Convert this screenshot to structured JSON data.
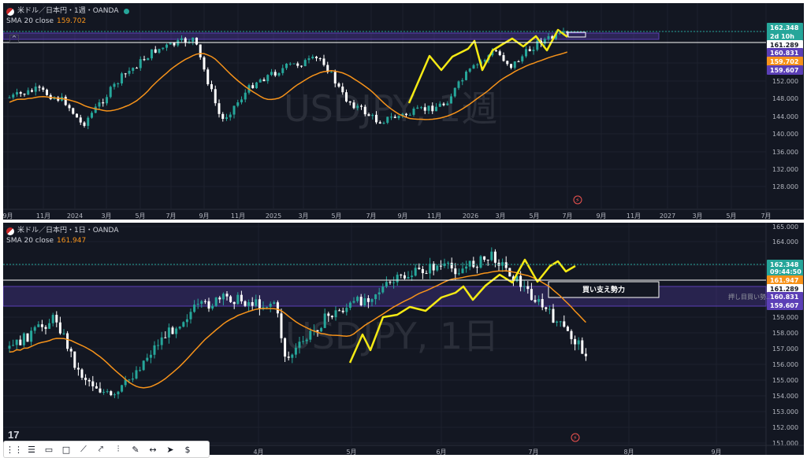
{
  "weekly": {
    "title": "米ドル／日本円・1週・OANDA",
    "sma_label": "SMA 20 close",
    "sma_value": "159.702",
    "watermark": "USDJPY, 1週",
    "y_axis": [
      "164.000",
      "156.000",
      "152.000",
      "148.000",
      "144.000",
      "140.000",
      "136.000",
      "132.000",
      "128.000"
    ],
    "x_axis": [
      "9月",
      "11月",
      "2024",
      "3月",
      "5月",
      "7月",
      "9月",
      "11月",
      "2025",
      "3月",
      "5月",
      "7月",
      "9月",
      "11月",
      "2026",
      "3月",
      "5月",
      "7月",
      "9月",
      "11月",
      "2027",
      "3月",
      "5月",
      "7月"
    ],
    "price_tags": [
      {
        "text": "162.348",
        "color": "#26a69a"
      },
      {
        "text": "2d 10h",
        "color": "#26a69a"
      },
      {
        "text": "161.289",
        "color": "#ffffff"
      },
      {
        "text": "160.831",
        "color": "#5b3fb6"
      },
      {
        "text": "159.702",
        "color": "#f7931a"
      },
      {
        "text": "159.607",
        "color": "#5b3fb6"
      }
    ]
  },
  "daily": {
    "title": "米ドル／日本円・1日・OANDA",
    "sma_label": "SMA 20 close",
    "sma_value": "161.947",
    "watermark": "USDJPY, 1日",
    "y_axis": [
      "165.000",
      "164.000",
      "163.000",
      "159.000",
      "158.000",
      "157.000",
      "156.000",
      "155.000",
      "154.000",
      "153.000",
      "152.000",
      "151.000"
    ],
    "x_axis": [
      "4月",
      "5月",
      "6月",
      "7月",
      "8月",
      "9月"
    ],
    "price_tags": [
      {
        "text": "162.348",
        "color": "#26a69a"
      },
      {
        "text": "09:44:50",
        "color": "#26a69a"
      },
      {
        "text": "161.947",
        "color": "#f7931a"
      },
      {
        "text": "161.289",
        "color": "#ffffff"
      },
      {
        "text": "160.831",
        "color": "#5b3fb6"
      },
      {
        "text": "159.607",
        "color": "#5b3fb6"
      }
    ],
    "zone_label": "買い支え勢力",
    "zone_right_label": "押し目買い勢..."
  },
  "toolbar": {
    "tools": [
      "drag-handle-icon",
      "lines-icon",
      "callout-icon",
      "rectangle-icon",
      "trendline-icon",
      "path-icon",
      "position-icon",
      "brush-icon",
      "measure-icon",
      "cursor-icon",
      "dollar-icon"
    ]
  },
  "logo_text": "17",
  "colors": {
    "up": "#26a69a",
    "down": "#ffffff",
    "sma": "#f7931a",
    "zigzag": "#f5ea14",
    "zone": "#5b3fb6",
    "bg": "#131722",
    "grid": "#1e222d",
    "text": "#d1d4dc"
  }
}
